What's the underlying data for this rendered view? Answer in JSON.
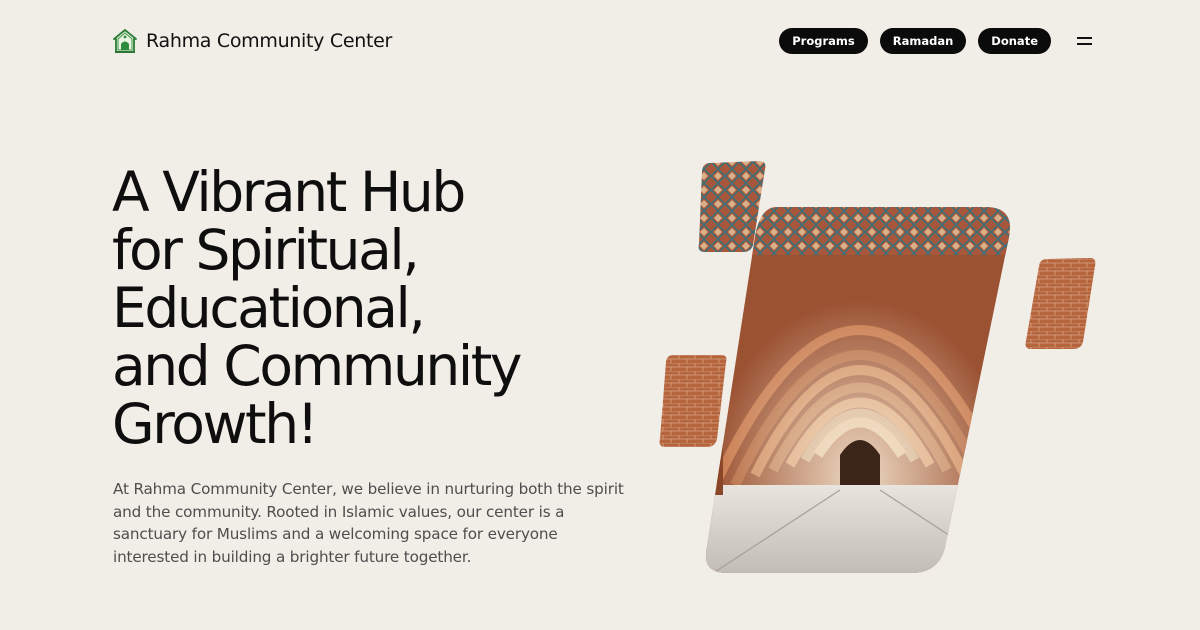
{
  "header": {
    "brand_name": "Rahma Community Center",
    "logo_icon": "mosque-house-icon",
    "nav": [
      "Programs",
      "Ramadan",
      "Donate"
    ],
    "menu_icon": "hamburger-menu-icon"
  },
  "hero": {
    "title_lines": [
      "A Vibrant Hub",
      "for Spiritual,",
      "Educational,",
      "and Community",
      "Growth!"
    ],
    "description_lines": [
      "At Rahma Community Center, we believe in nurturing both the spirit",
      "and the community. Rooted in Islamic values, our center is a",
      "sanctuary for Muslims and a welcoming space for everyone",
      "interested in building a brighter future together."
    ]
  },
  "colors": {
    "background": "#f1ede7",
    "text": "#121212",
    "pill": "#0b0b0b",
    "logo_green": "#2e8b3a",
    "brick": "#b5643c"
  }
}
